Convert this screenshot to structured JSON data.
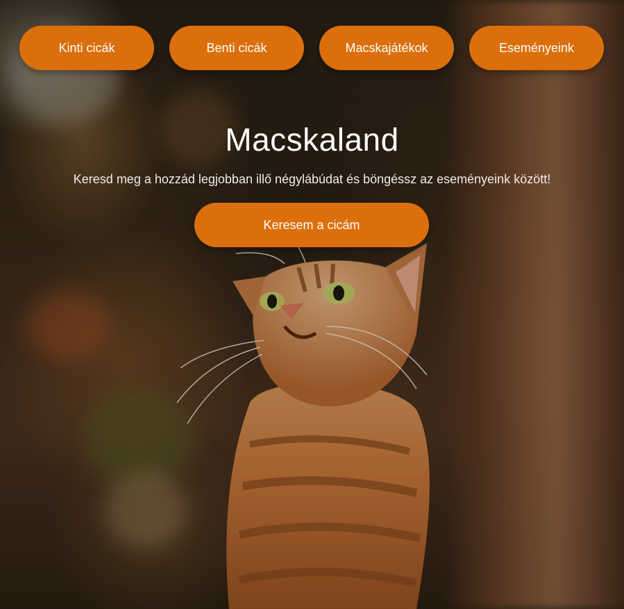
{
  "nav": {
    "items": [
      {
        "label": "Kinti cicák"
      },
      {
        "label": "Benti cicák"
      },
      {
        "label": "Macskajátékok"
      },
      {
        "label": "Eseményeink"
      }
    ]
  },
  "hero": {
    "title": "Macskaland",
    "subtitle": "Keresd meg a hozzád legjobban illő négylábúdat és böngéssz az eseményeink között!",
    "cta_label": "Keresem a cicám",
    "background_image": "tabby-cat-looking-up-photo"
  },
  "colors": {
    "accent": "#db6f0c",
    "text": "#ffffff"
  }
}
